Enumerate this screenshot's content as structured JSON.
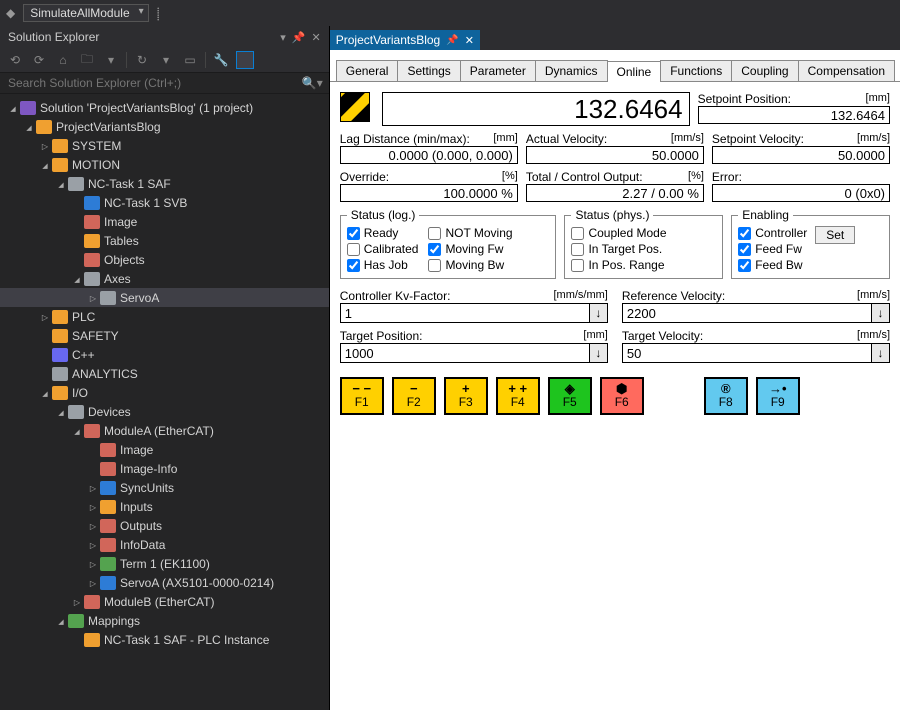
{
  "top": {
    "combo": "SimulateAllModule"
  },
  "explorer": {
    "title": "Solution Explorer",
    "search_placeholder": "Search Solution Explorer (Ctrl+;)",
    "tree": [
      {
        "depth": 0,
        "arrow": "open",
        "icon": "sln",
        "color": "#7e57c2",
        "label": "Solution 'ProjectVariantsBlog' (1 project)"
      },
      {
        "depth": 1,
        "arrow": "open",
        "icon": "proj",
        "color": "#f0a030",
        "label": "ProjectVariantsBlog"
      },
      {
        "depth": 2,
        "arrow": "closed",
        "icon": "sys",
        "color": "#f0a030",
        "label": "SYSTEM"
      },
      {
        "depth": 2,
        "arrow": "open",
        "icon": "mot",
        "color": "#f0a030",
        "label": "MOTION"
      },
      {
        "depth": 3,
        "arrow": "open",
        "icon": "nc",
        "color": "#9aa0a6",
        "label": "NC-Task 1 SAF"
      },
      {
        "depth": 4,
        "arrow": "none",
        "icon": "svb",
        "color": "#2d7cd6",
        "label": "NC-Task 1 SVB"
      },
      {
        "depth": 4,
        "arrow": "none",
        "icon": "img",
        "color": "#d1665a",
        "label": "Image"
      },
      {
        "depth": 4,
        "arrow": "none",
        "icon": "tbl",
        "color": "#f0a030",
        "label": "Tables"
      },
      {
        "depth": 4,
        "arrow": "none",
        "icon": "obj",
        "color": "#d1665a",
        "label": "Objects"
      },
      {
        "depth": 4,
        "arrow": "open",
        "icon": "ax",
        "color": "#9aa0a6",
        "label": "Axes"
      },
      {
        "depth": 5,
        "arrow": "closed",
        "icon": "srv",
        "color": "#9aa0a6",
        "label": "ServoA",
        "selected": true
      },
      {
        "depth": 2,
        "arrow": "closed",
        "icon": "plc",
        "color": "#f0a030",
        "label": "PLC"
      },
      {
        "depth": 2,
        "arrow": "none",
        "icon": "safe",
        "color": "#f0a030",
        "label": "SAFETY"
      },
      {
        "depth": 2,
        "arrow": "none",
        "icon": "cpp",
        "color": "#6868f0",
        "label": "C++"
      },
      {
        "depth": 2,
        "arrow": "none",
        "icon": "ana",
        "color": "#9aa0a6",
        "label": "ANALYTICS"
      },
      {
        "depth": 2,
        "arrow": "open",
        "icon": "io",
        "color": "#f0a030",
        "label": "I/O"
      },
      {
        "depth": 3,
        "arrow": "open",
        "icon": "dev",
        "color": "#9aa0a6",
        "label": "Devices"
      },
      {
        "depth": 4,
        "arrow": "open",
        "icon": "ecat",
        "color": "#d1665a",
        "label": "ModuleA (EtherCAT)"
      },
      {
        "depth": 5,
        "arrow": "none",
        "icon": "img",
        "color": "#d1665a",
        "label": "Image"
      },
      {
        "depth": 5,
        "arrow": "none",
        "icon": "img",
        "color": "#d1665a",
        "label": "Image-Info"
      },
      {
        "depth": 5,
        "arrow": "closed",
        "icon": "sync",
        "color": "#2d7cd6",
        "label": "SyncUnits"
      },
      {
        "depth": 5,
        "arrow": "closed",
        "icon": "in",
        "color": "#f0a030",
        "label": "Inputs"
      },
      {
        "depth": 5,
        "arrow": "closed",
        "icon": "out",
        "color": "#d1665a",
        "label": "Outputs"
      },
      {
        "depth": 5,
        "arrow": "closed",
        "icon": "info",
        "color": "#d1665a",
        "label": "InfoData"
      },
      {
        "depth": 5,
        "arrow": "closed",
        "icon": "term",
        "color": "#54a34f",
        "label": "Term 1 (EK1100)"
      },
      {
        "depth": 5,
        "arrow": "closed",
        "icon": "drv",
        "color": "#2d7cd6",
        "label": "ServoA (AX5101-0000-0214)"
      },
      {
        "depth": 4,
        "arrow": "closed",
        "icon": "ecat",
        "color": "#d1665a",
        "label": "ModuleB (EtherCAT)"
      },
      {
        "depth": 3,
        "arrow": "open",
        "icon": "map",
        "color": "#54a34f",
        "label": "Mappings"
      },
      {
        "depth": 4,
        "arrow": "none",
        "icon": "link",
        "color": "#f0a030",
        "label": "NC-Task 1 SAF - PLC Instance"
      }
    ]
  },
  "doc": {
    "tab": "ProjectVariantsBlog"
  },
  "tabs": [
    "General",
    "Settings",
    "Parameter",
    "Dynamics",
    "Online",
    "Functions",
    "Coupling",
    "Compensation"
  ],
  "active_tab": "Online",
  "readouts": {
    "big_position": "132.6464",
    "setpoint_pos_label": "Setpoint Position:",
    "setpoint_pos_unit": "[mm]",
    "setpoint_pos_val": "132.6464",
    "lag_label": "Lag Distance (min/max):",
    "lag_unit": "[mm]",
    "lag_val": "0.0000 (0.000, 0.000)",
    "actvel_label": "Actual Velocity:",
    "actvel_unit": "[mm/s]",
    "actvel_val": "50.0000",
    "setvel_label": "Setpoint Velocity:",
    "setvel_unit": "[mm/s]",
    "setvel_val": "50.0000",
    "override_label": "Override:",
    "override_unit": "[%]",
    "override_val": "100.0000 %",
    "total_label": "Total / Control Output:",
    "total_unit": "[%]",
    "total_val": "2.27 /  0.00 %",
    "error_label": "Error:",
    "error_val": "0 (0x0)"
  },
  "status_log": {
    "legend": "Status (log.)",
    "ready": {
      "label": "Ready",
      "checked": true
    },
    "calibrated": {
      "label": "Calibrated",
      "checked": false
    },
    "hasjob": {
      "label": "Has Job",
      "checked": true
    },
    "notmoving": {
      "label": "NOT Moving",
      "checked": false
    },
    "movfw": {
      "label": "Moving Fw",
      "checked": true
    },
    "movbw": {
      "label": "Moving Bw",
      "checked": false
    }
  },
  "status_phys": {
    "legend": "Status (phys.)",
    "coupled": {
      "label": "Coupled Mode",
      "checked": false
    },
    "intarget": {
      "label": "In Target Pos.",
      "checked": false
    },
    "inpos": {
      "label": "In Pos. Range",
      "checked": false
    }
  },
  "enabling": {
    "legend": "Enabling",
    "controller": {
      "label": "Controller",
      "checked": true
    },
    "feedfw": {
      "label": "Feed Fw",
      "checked": true
    },
    "feedbw": {
      "label": "Feed Bw",
      "checked": true
    },
    "set_btn": "Set"
  },
  "params": {
    "kv": {
      "label": "Controller Kv-Factor:",
      "unit": "[mm/s/mm]",
      "val": "1"
    },
    "refvel": {
      "label": "Reference Velocity:",
      "unit": "[mm/s]",
      "val": "2200"
    },
    "tgtpos": {
      "label": "Target Position:",
      "unit": "[mm]",
      "val": "1000"
    },
    "tgtvel": {
      "label": "Target Velocity:",
      "unit": "[mm/s]",
      "val": "50"
    }
  },
  "fkeys": {
    "f1": {
      "sym": "− −",
      "txt": "F1"
    },
    "f2": {
      "sym": "−",
      "txt": "F2"
    },
    "f3": {
      "sym": "+",
      "txt": "F3"
    },
    "f4": {
      "sym": "+ +",
      "txt": "F4"
    },
    "f5": {
      "sym": "◈",
      "txt": "F5"
    },
    "f6": {
      "sym": "⬢",
      "txt": "F6"
    },
    "f8": {
      "sym": "®",
      "txt": "F8"
    },
    "f9": {
      "sym": "→•",
      "txt": "F9"
    }
  }
}
